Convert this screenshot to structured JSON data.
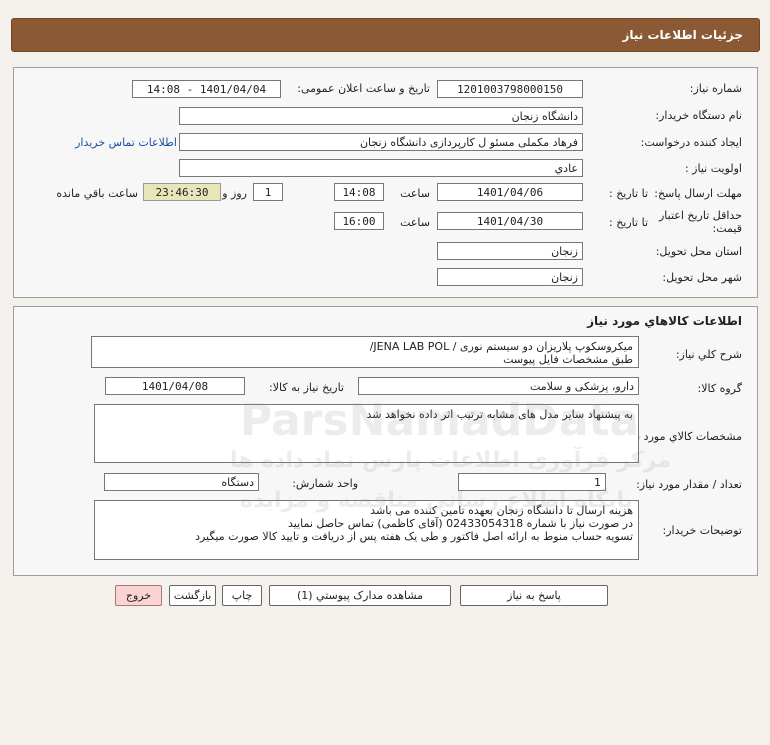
{
  "header": {
    "title": "جزئیات اطلاعات نیاز"
  },
  "info": {
    "need_number_label": "شماره نیاز:",
    "need_number": "1201003798000150",
    "announce_label": "تاریخ و ساعت اعلان عمومی:",
    "announce_value": "1401/04/04 - 14:08",
    "buyer_label": "نام دستگاه خریدار:",
    "buyer_value": "دانشگاه زنجان",
    "creator_label": "ایجاد کننده درخواست:",
    "creator_value": "فرهاد مکملی مسئو ل کارپردازی دانشگاه زنجان",
    "contact_link": "اطلاعات تماس خریدار",
    "priority_label": "اولویت نیاز :",
    "priority_value": "عادي",
    "deadline_label": "مهلت ارسال پاسخ:",
    "to_date_label": "تا تاریخ :",
    "deadline_date": "1401/04/06",
    "time_label": "ساعت",
    "deadline_time": "14:08",
    "days_value": "1",
    "days_label": "روز و",
    "remaining_time": "23:46:30",
    "remaining_label": "ساعت باقي مانده",
    "validity_label": "حداقل تاریخ اعتبار قیمت:",
    "validity_to_label": "تا تاریخ :",
    "validity_date": "1401/04/30",
    "validity_time_label": "ساعت",
    "validity_time": "16:00",
    "province_label": "استان محل تحویل:",
    "province_value": "زنجان",
    "city_label": "شهر محل تحویل:",
    "city_value": "زنجان"
  },
  "goods": {
    "section_title": "اطلاعات کالاهاي مورد نياز",
    "summary_label": "شرح کلي نياز:",
    "summary_line1": "میکروسکوپ پلاریزان دو سیستم نوری / JENA LAB POL/",
    "summary_line2": "طبق مشخصات فایل پیوست",
    "group_label": "گروه کالا:",
    "group_value": "دارو، پزشکی و سلامت",
    "need_date_label": "تاریخ نیاز به کالا:",
    "need_date_value": "1401/04/08",
    "specs_label": "مشخصات کالاي مورد نياز:",
    "specs_value": "به پیشنهاد سایر مدل های مشابه ترتیب اثر داده نخواهد شد",
    "qty_label": "تعداد / مقدار مورد نیاز:",
    "qty_value": "1",
    "unit_label": "واحد شمارش:",
    "unit_value": "دستگاه",
    "buyer_notes_label": "توضیحات خریدار:",
    "notes_line1": "هزینه ارسال تا دانشگاه زنجان بعهده تامین کننده می باشد",
    "notes_line2": "در صورت نیاز با شماره 02433054318 (آقای کاظمی) تماس حاصل نمایید",
    "notes_line3": "تسویه حساب منوط به ارائه اصل فاکتور و طی یک هفته پس از دریافت و تایید کالا صورت میگیرد"
  },
  "buttons": {
    "reply": "پاسخ به نیاز",
    "attachments": "مشاهده مدارک پیوستي (1)",
    "print": "چاپ",
    "back": "بازگشت",
    "exit": "خروج"
  },
  "watermark": {
    "text1": "ParsNamadData",
    "text2": "مرکز فرآوری اطلاعات پارس نماد داده ها",
    "text3": "پایگاه اطلاع رسانی مناقصه و مزایده"
  }
}
